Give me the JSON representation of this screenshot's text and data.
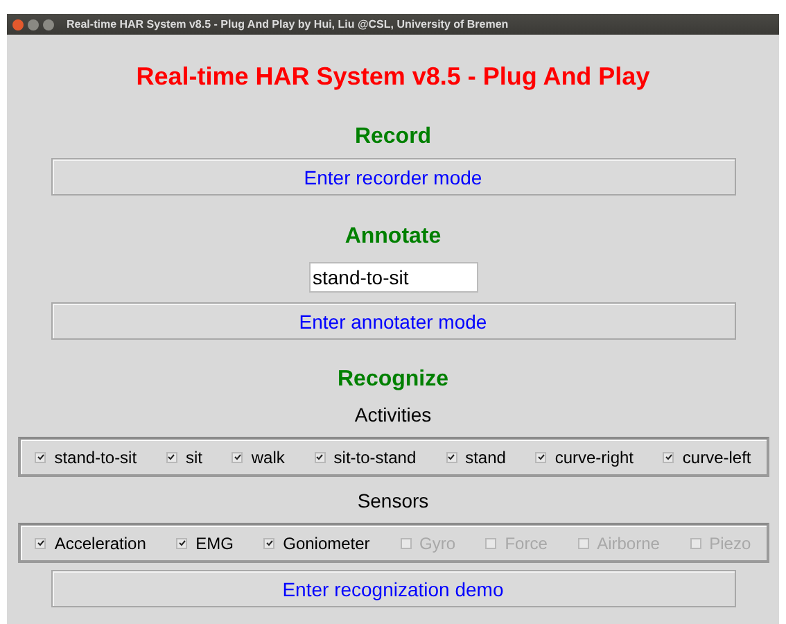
{
  "window": {
    "title": "Real-time HAR System v8.5 - Plug And Play by Hui, Liu @CSL, University of Bremen"
  },
  "heading": "Real-time HAR System v8.5 - Plug And Play",
  "record": {
    "title": "Record",
    "button": "Enter recorder mode"
  },
  "annotate": {
    "title": "Annotate",
    "field_value": "stand-to-sit",
    "button": "Enter annotater mode"
  },
  "recognize": {
    "title": "Recognize",
    "activities_label": "Activities",
    "activities": [
      {
        "label": "stand-to-sit",
        "checked": true,
        "disabled": false
      },
      {
        "label": "sit",
        "checked": true,
        "disabled": false
      },
      {
        "label": "walk",
        "checked": true,
        "disabled": false
      },
      {
        "label": "sit-to-stand",
        "checked": true,
        "disabled": false
      },
      {
        "label": "stand",
        "checked": true,
        "disabled": false
      },
      {
        "label": "curve-right",
        "checked": true,
        "disabled": false
      },
      {
        "label": "curve-left",
        "checked": true,
        "disabled": false
      }
    ],
    "sensors_label": "Sensors",
    "sensors": [
      {
        "label": "Acceleration",
        "checked": true,
        "disabled": false
      },
      {
        "label": "EMG",
        "checked": true,
        "disabled": false
      },
      {
        "label": "Goniometer",
        "checked": true,
        "disabled": false
      },
      {
        "label": "Gyro",
        "checked": false,
        "disabled": true
      },
      {
        "label": "Force",
        "checked": false,
        "disabled": true
      },
      {
        "label": "Airborne",
        "checked": false,
        "disabled": true
      },
      {
        "label": "Piezo",
        "checked": false,
        "disabled": true
      }
    ],
    "button": "Enter recognization demo"
  }
}
